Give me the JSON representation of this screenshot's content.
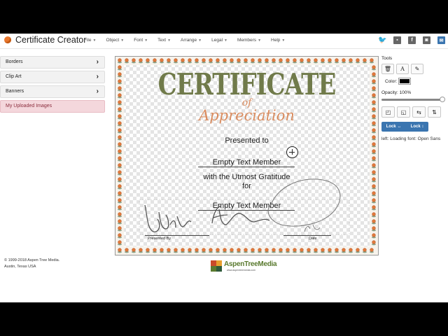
{
  "header": {
    "title": "Certificate Creator",
    "menu": [
      "File",
      "Object",
      "Font",
      "Text",
      "Arrange",
      "Legal",
      "Members",
      "Help"
    ],
    "social_icons": [
      "twitter-icon",
      "share-icon",
      "facebook-icon",
      "instagram-icon",
      "mail-icon"
    ]
  },
  "sidebar": {
    "items": [
      {
        "label": "Borders"
      },
      {
        "label": "Clip Art"
      },
      {
        "label": "Banners"
      },
      {
        "label": "My Uploaded Images"
      }
    ],
    "copyright_line1": "© 1999-2018 Aspen Tree Media.",
    "copyright_line2": "Austin, Texas USA"
  },
  "certificate": {
    "title": "CERTIFICATE",
    "of": "of",
    "appreciation": "Appreciation",
    "presented_to": "Presented to",
    "member1": "Empty Text Member",
    "gratitude": "with the Utmost Gratitude",
    "for": "for",
    "member2": "Empty Text Member",
    "presented_by": "Presented By",
    "date": "Date"
  },
  "footer": {
    "logo_text": "AspenTreeMedia",
    "logo_sub": "www.aspentreemedia.com"
  },
  "tools": {
    "title": "Tools",
    "color_label": "Color:",
    "color_value": "#000000",
    "opacity_label": "Opacity: 100%",
    "opacity": 1.0,
    "lock_h": "Lock ↔",
    "lock_v": "Lock ↕",
    "status": "left: Loading font: Open Sans"
  },
  "colors": {
    "accent": "#3a75b0",
    "active_sidebar": "#f4d7dc",
    "cert_olive": "#707a4a",
    "cert_orange": "#d98c5f"
  }
}
